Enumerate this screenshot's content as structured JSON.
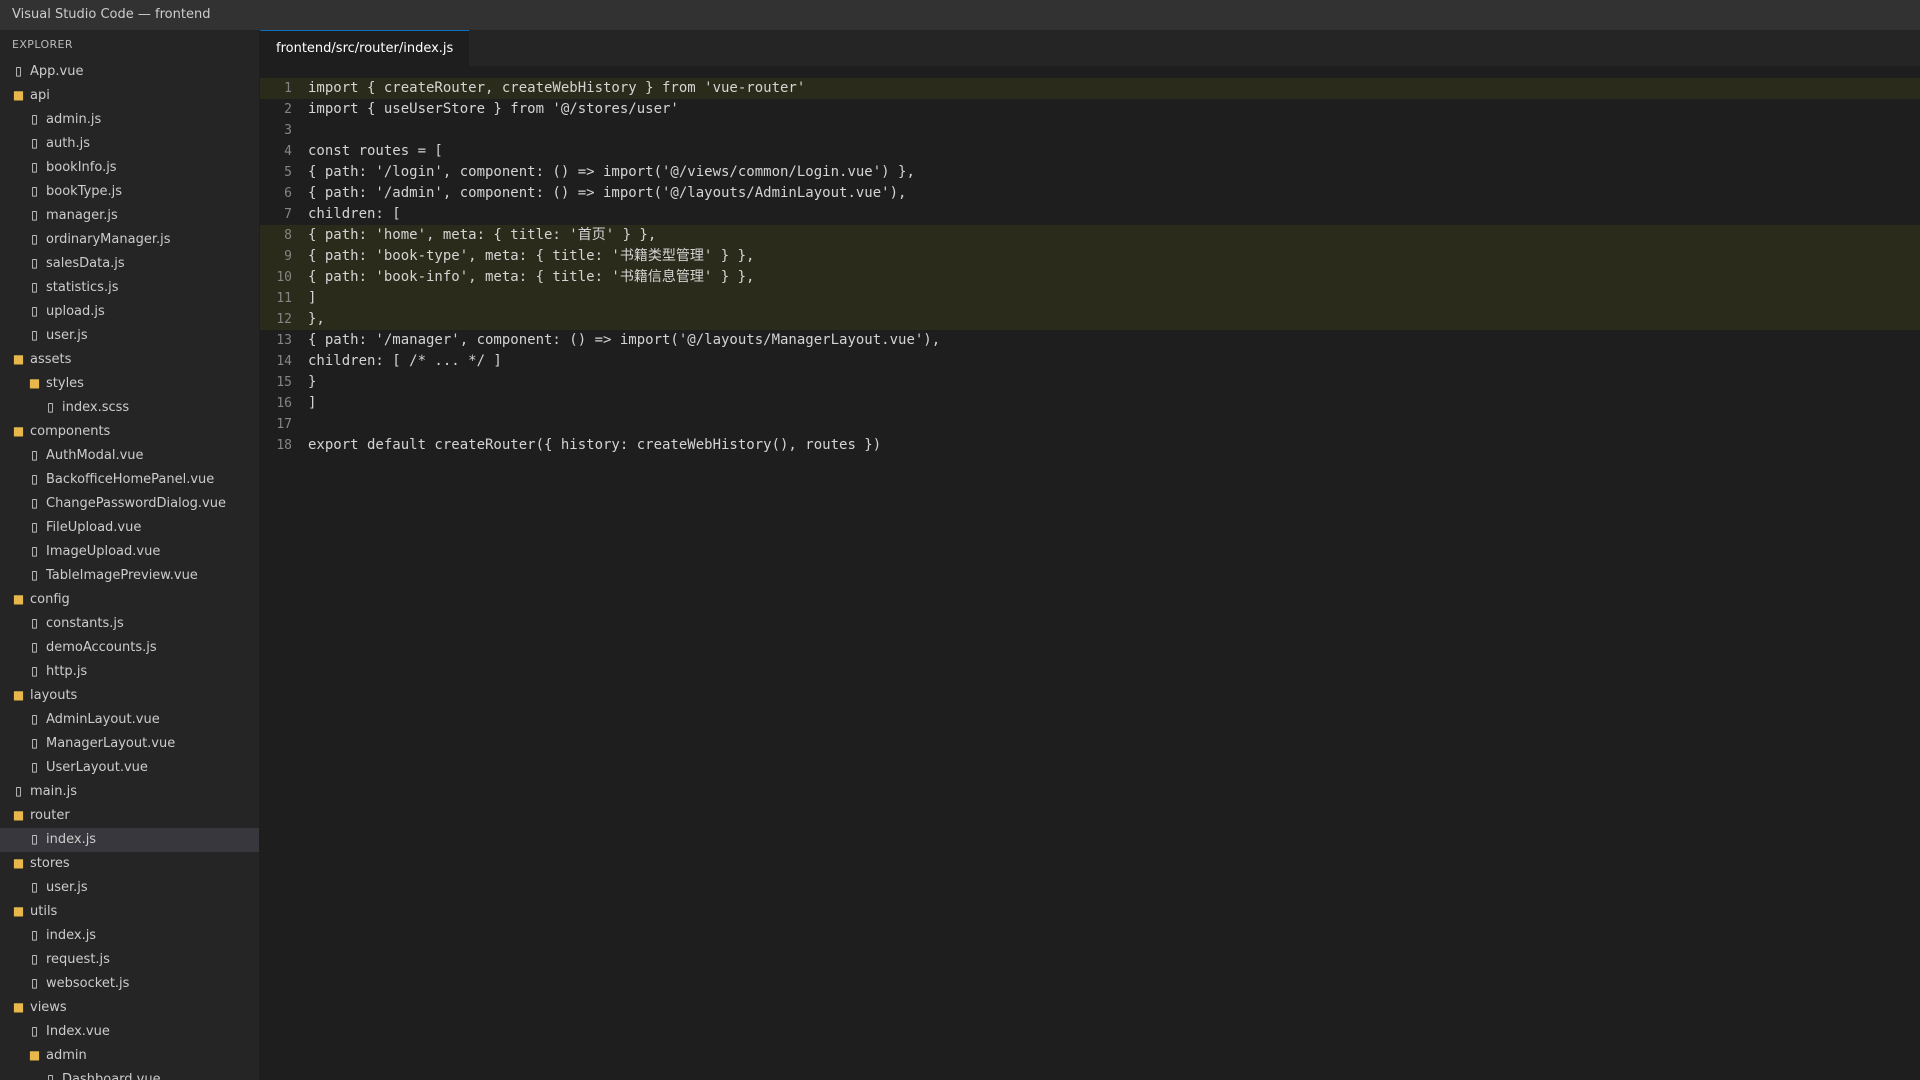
{
  "window": {
    "title": "Visual Studio Code — frontend"
  },
  "sidebar": {
    "header": "EXPLORER",
    "items": [
      {
        "label": "App.vue",
        "type": "file",
        "depth": 0
      },
      {
        "label": "api",
        "type": "folder",
        "depth": 0
      },
      {
        "label": "admin.js",
        "type": "file",
        "depth": 1
      },
      {
        "label": "auth.js",
        "type": "file",
        "depth": 1
      },
      {
        "label": "bookInfo.js",
        "type": "file",
        "depth": 1
      },
      {
        "label": "bookType.js",
        "type": "file",
        "depth": 1
      },
      {
        "label": "manager.js",
        "type": "file",
        "depth": 1
      },
      {
        "label": "ordinaryManager.js",
        "type": "file",
        "depth": 1
      },
      {
        "label": "salesData.js",
        "type": "file",
        "depth": 1
      },
      {
        "label": "statistics.js",
        "type": "file",
        "depth": 1
      },
      {
        "label": "upload.js",
        "type": "file",
        "depth": 1
      },
      {
        "label": "user.js",
        "type": "file",
        "depth": 1
      },
      {
        "label": "assets",
        "type": "folder",
        "depth": 0
      },
      {
        "label": "styles",
        "type": "folder",
        "depth": 1
      },
      {
        "label": "index.scss",
        "type": "file",
        "depth": 2
      },
      {
        "label": "components",
        "type": "folder",
        "depth": 0
      },
      {
        "label": "AuthModal.vue",
        "type": "file",
        "depth": 1
      },
      {
        "label": "BackofficeHomePanel.vue",
        "type": "file",
        "depth": 1
      },
      {
        "label": "ChangePasswordDialog.vue",
        "type": "file",
        "depth": 1
      },
      {
        "label": "FileUpload.vue",
        "type": "file",
        "depth": 1
      },
      {
        "label": "ImageUpload.vue",
        "type": "file",
        "depth": 1
      },
      {
        "label": "TableImagePreview.vue",
        "type": "file",
        "depth": 1
      },
      {
        "label": "config",
        "type": "folder",
        "depth": 0
      },
      {
        "label": "constants.js",
        "type": "file",
        "depth": 1
      },
      {
        "label": "demoAccounts.js",
        "type": "file",
        "depth": 1
      },
      {
        "label": "http.js",
        "type": "file",
        "depth": 1
      },
      {
        "label": "layouts",
        "type": "folder",
        "depth": 0
      },
      {
        "label": "AdminLayout.vue",
        "type": "file",
        "depth": 1
      },
      {
        "label": "ManagerLayout.vue",
        "type": "file",
        "depth": 1
      },
      {
        "label": "UserLayout.vue",
        "type": "file",
        "depth": 1
      },
      {
        "label": "main.js",
        "type": "file",
        "depth": 0
      },
      {
        "label": "router",
        "type": "folder",
        "depth": 0
      },
      {
        "label": "index.js",
        "type": "file",
        "depth": 1,
        "selected": true
      },
      {
        "label": "stores",
        "type": "folder",
        "depth": 0
      },
      {
        "label": "user.js",
        "type": "file",
        "depth": 1
      },
      {
        "label": "utils",
        "type": "folder",
        "depth": 0
      },
      {
        "label": "index.js",
        "type": "file",
        "depth": 1
      },
      {
        "label": "request.js",
        "type": "file",
        "depth": 1
      },
      {
        "label": "websocket.js",
        "type": "file",
        "depth": 1
      },
      {
        "label": "views",
        "type": "folder",
        "depth": 0
      },
      {
        "label": "Index.vue",
        "type": "file",
        "depth": 1
      },
      {
        "label": "admin",
        "type": "folder",
        "depth": 1
      },
      {
        "label": "Dashboard.vue",
        "type": "file",
        "depth": 2
      }
    ]
  },
  "editor": {
    "tab_label": "frontend/src/router/index.js",
    "lines": [
      {
        "num": "1",
        "text": "import { createRouter, createWebHistory } from 'vue-router'",
        "hl": true
      },
      {
        "num": "2",
        "text": "import { useUserStore } from '@/stores/user'",
        "hl": false
      },
      {
        "num": "3",
        "text": "",
        "hl": false
      },
      {
        "num": "4",
        "text": "const routes = [",
        "hl": false
      },
      {
        "num": "5",
        "text": "{ path: '/login', component: () => import('@/views/common/Login.vue') },",
        "hl": false
      },
      {
        "num": "6",
        "text": "{ path: '/admin', component: () => import('@/layouts/AdminLayout.vue'),",
        "hl": false
      },
      {
        "num": "7",
        "text": "children: [",
        "hl": false
      },
      {
        "num": "8",
        "text": "{ path: 'home', meta: { title: '首页' } },",
        "hl": true
      },
      {
        "num": "9",
        "text": "{ path: 'book-type', meta: { title: '书籍类型管理' } },",
        "hl": true
      },
      {
        "num": "10",
        "text": "{ path: 'book-info', meta: { title: '书籍信息管理' } },",
        "hl": true
      },
      {
        "num": "11",
        "text": "]",
        "hl": true
      },
      {
        "num": "12",
        "text": "},",
        "hl": true
      },
      {
        "num": "13",
        "text": "{ path: '/manager', component: () => import('@/layouts/ManagerLayout.vue'),",
        "hl": false
      },
      {
        "num": "14",
        "text": "children: [ /* ... */ ]",
        "hl": false
      },
      {
        "num": "15",
        "text": "}",
        "hl": false
      },
      {
        "num": "16",
        "text": "]",
        "hl": false
      },
      {
        "num": "17",
        "text": "",
        "hl": false
      },
      {
        "num": "18",
        "text": "export default createRouter({ history: createWebHistory(), routes })",
        "hl": false
      }
    ]
  },
  "colors": {
    "highlight": "#2b2b1b",
    "selected_item": "#37373d",
    "folder_icon": "#e8b84a"
  }
}
